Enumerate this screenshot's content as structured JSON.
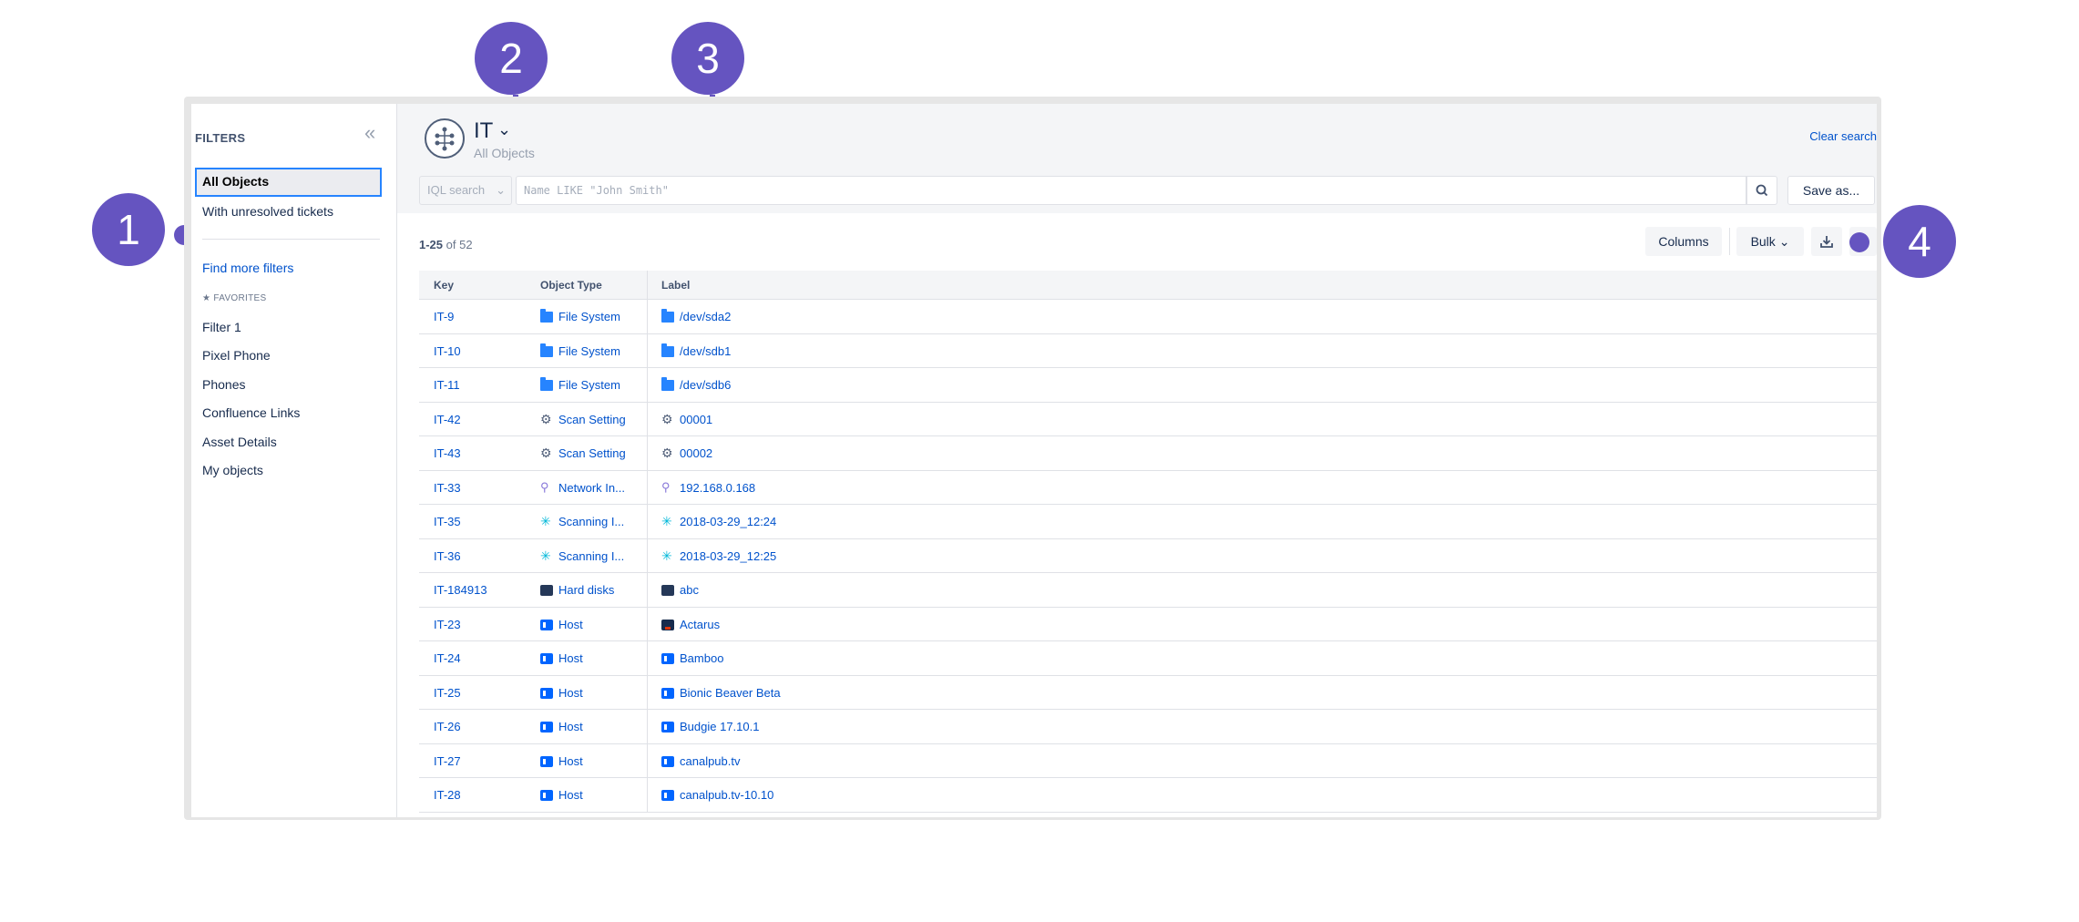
{
  "sidebar": {
    "title": "FILTERS",
    "items": [
      {
        "label": "All Objects",
        "active": true
      },
      {
        "label": "With unresolved tickets"
      }
    ],
    "find_more": "Find more filters",
    "favorites_title": "FAVORITES",
    "favorites": [
      "Filter 1",
      "Pixel Phone",
      "Phones",
      "Confluence Links",
      "Asset Details",
      "My objects"
    ]
  },
  "header": {
    "schema_name": "IT",
    "subtitle": "All Objects",
    "clear_search": "Clear search",
    "iql_dropdown": "IQL search",
    "search_placeholder": "Name LIKE \"John Smith\"",
    "save_as": "Save as..."
  },
  "toolbar": {
    "count_range": "1-25",
    "count_total": "of 52",
    "columns_label": "Columns",
    "bulk_label": "Bulk"
  },
  "table": {
    "headers": [
      "Key",
      "Object Type",
      "Label"
    ],
    "rows": [
      {
        "key": "IT-9",
        "type": "File System",
        "type_icon": "folder-icon",
        "label": "/dev/sda2",
        "label_icon": "folder-icon"
      },
      {
        "key": "IT-10",
        "type": "File System",
        "type_icon": "folder-icon",
        "label": "/dev/sdb1",
        "label_icon": "folder-icon"
      },
      {
        "key": "IT-11",
        "type": "File System",
        "type_icon": "folder-icon",
        "label": "/dev/sdb6",
        "label_icon": "folder-icon"
      },
      {
        "key": "IT-42",
        "type": "Scan Setting",
        "type_icon": "gear-icon",
        "label": "00001",
        "label_icon": "gear-icon"
      },
      {
        "key": "IT-43",
        "type": "Scan Setting",
        "type_icon": "gear-icon",
        "label": "00002",
        "label_icon": "gear-icon"
      },
      {
        "key": "IT-33",
        "type": "Network In...",
        "type_icon": "network-icon",
        "label": "192.168.0.168",
        "label_icon": "network-icon"
      },
      {
        "key": "IT-35",
        "type": "Scanning I...",
        "type_icon": "scan-icon",
        "label": "2018-03-29_12:24",
        "label_icon": "scan-icon"
      },
      {
        "key": "IT-36",
        "type": "Scanning I...",
        "type_icon": "scan-icon",
        "label": "2018-03-29_12:25",
        "label_icon": "scan-icon"
      },
      {
        "key": "IT-184913",
        "type": "Hard disks",
        "type_icon": "disk-icon",
        "label": "abc",
        "label_icon": "disk-icon"
      },
      {
        "key": "IT-23",
        "type": "Host",
        "type_icon": "host-icon",
        "label": "Actarus",
        "label_icon": "host-alt-icon"
      },
      {
        "key": "IT-24",
        "type": "Host",
        "type_icon": "host-icon",
        "label": "Bamboo",
        "label_icon": "host-icon"
      },
      {
        "key": "IT-25",
        "type": "Host",
        "type_icon": "host-icon",
        "label": "Bionic Beaver Beta",
        "label_icon": "host-icon"
      },
      {
        "key": "IT-26",
        "type": "Host",
        "type_icon": "host-icon",
        "label": "Budgie 17.10.1",
        "label_icon": "host-icon"
      },
      {
        "key": "IT-27",
        "type": "Host",
        "type_icon": "host-icon",
        "label": "canalpub.tv",
        "label_icon": "host-icon"
      },
      {
        "key": "IT-28",
        "type": "Host",
        "type_icon": "host-icon",
        "label": "canalpub.tv-10.10",
        "label_icon": "host-icon"
      }
    ]
  },
  "annotations": [
    "1",
    "2",
    "3",
    "4"
  ],
  "colors": {
    "accent": "#6554c0",
    "link": "#0052cc",
    "focus": "#2684ff"
  }
}
